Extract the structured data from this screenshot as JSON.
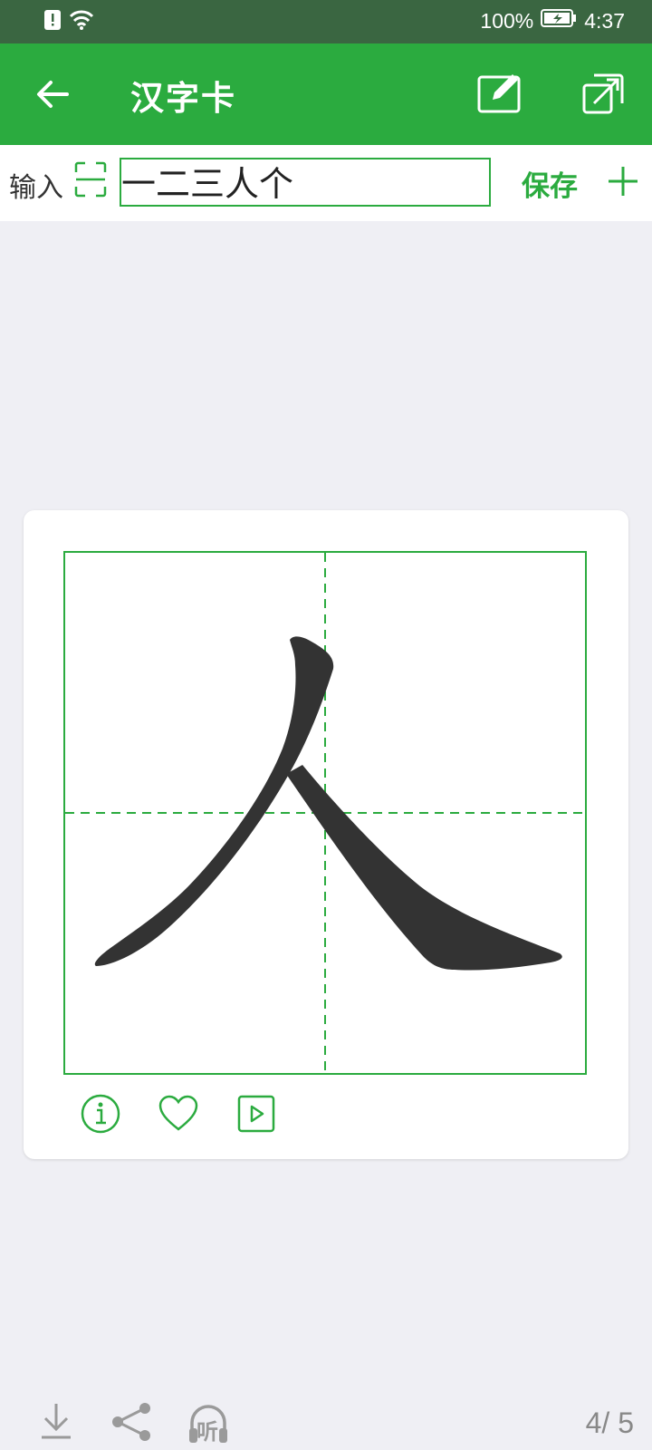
{
  "status": {
    "battery": "100%",
    "time": "4:37"
  },
  "appbar": {
    "title": "汉字卡"
  },
  "input": {
    "label": "输入",
    "value": "一二三人个",
    "save_label": "保存"
  },
  "card": {
    "character": "人"
  },
  "pager": {
    "text": "4/ 5"
  },
  "colors": {
    "accent": "#2bab3f",
    "status_bar": "#3a6641",
    "background": "#efeff4",
    "glyph": "#333333"
  },
  "icons": [
    "alert-icon",
    "wifi-icon",
    "battery-charging-icon",
    "back-arrow-icon",
    "edit-icon",
    "expand-icon",
    "scan-icon",
    "plus-icon",
    "info-icon",
    "heart-icon",
    "play-icon",
    "download-icon",
    "share-icon",
    "listen-icon"
  ],
  "bottom": {
    "listen_label": "听"
  }
}
